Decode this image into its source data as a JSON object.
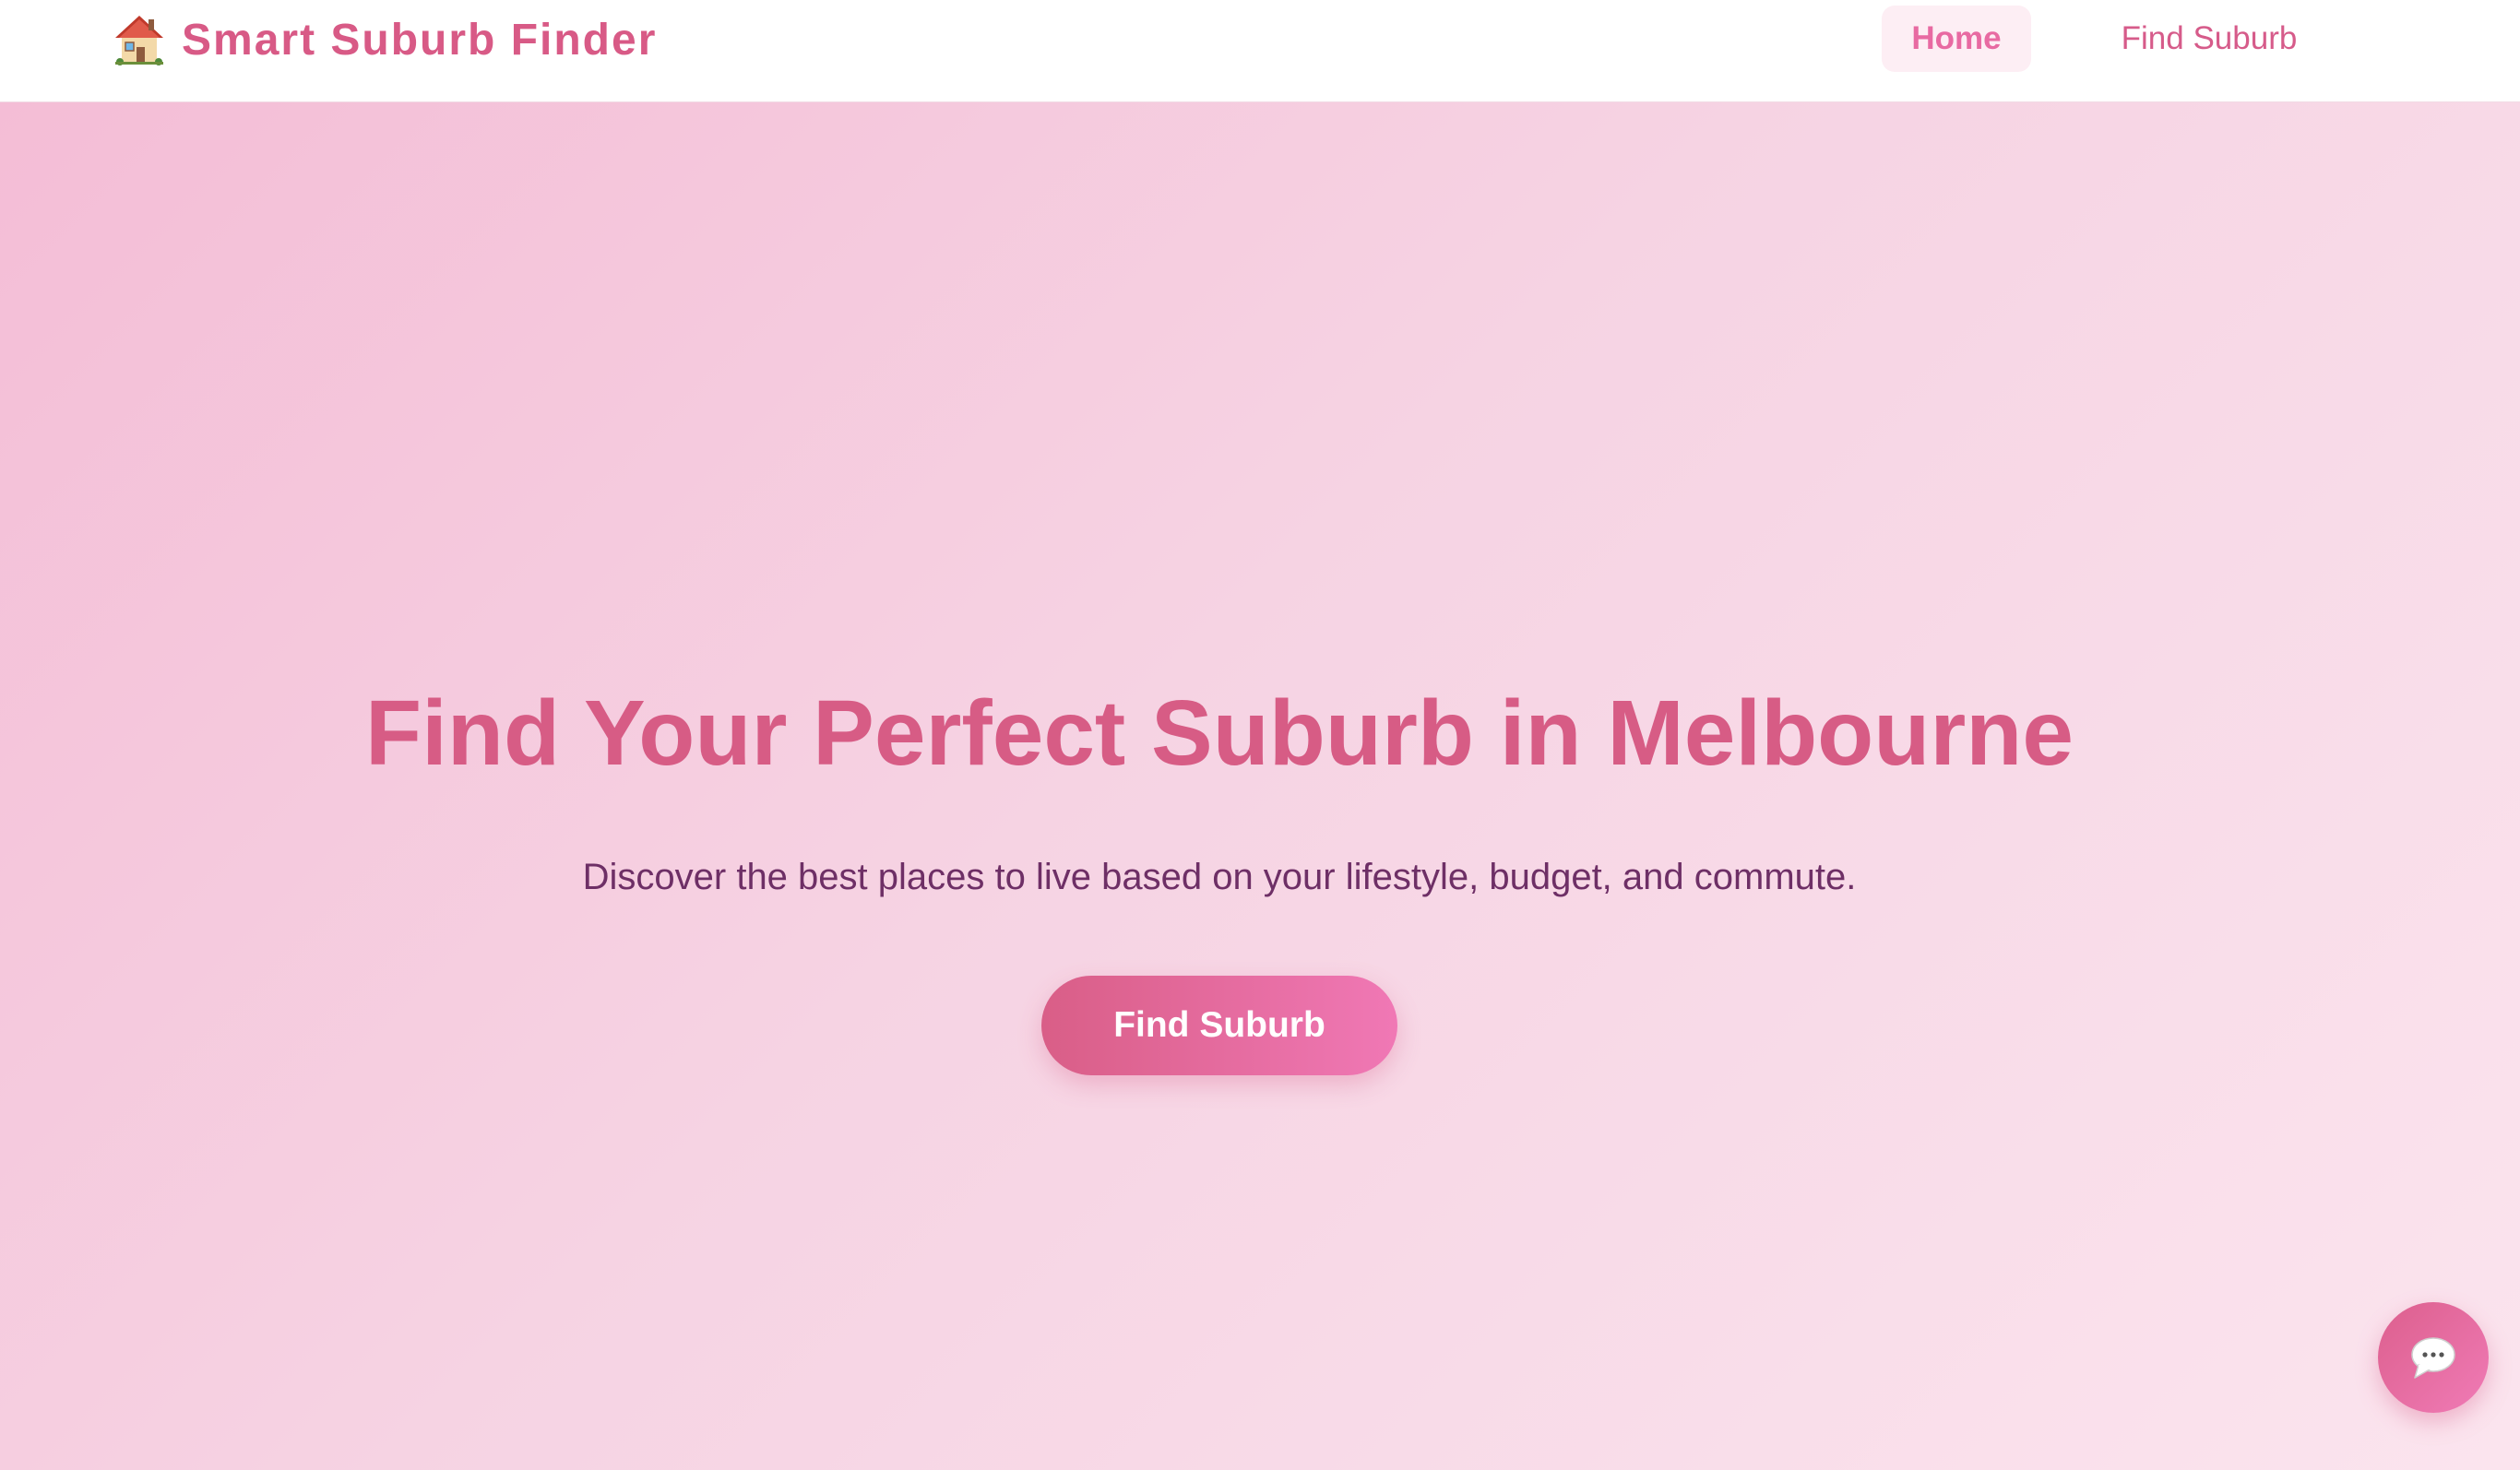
{
  "navbar": {
    "brand": {
      "icon": "house-emoji-icon",
      "title": "Smart Suburb Finder"
    },
    "links": [
      {
        "label": "Home",
        "active": true
      },
      {
        "label": "Find Suburb",
        "active": false
      }
    ]
  },
  "hero": {
    "title": "Find Your Perfect Suburb in Melbourne",
    "subtitle": "Discover the best places to live based on your lifestyle, budget, and commute.",
    "cta_label": "Find Suburb"
  },
  "chat": {
    "icon": "speech-bubble-icon"
  },
  "colors": {
    "brand": "#d85a86",
    "active_link": "#e86aa2",
    "subtitle": "#6e2f66",
    "hero_gradient_start": "#f4bdd6",
    "hero_gradient_end": "#fbe4ee"
  }
}
